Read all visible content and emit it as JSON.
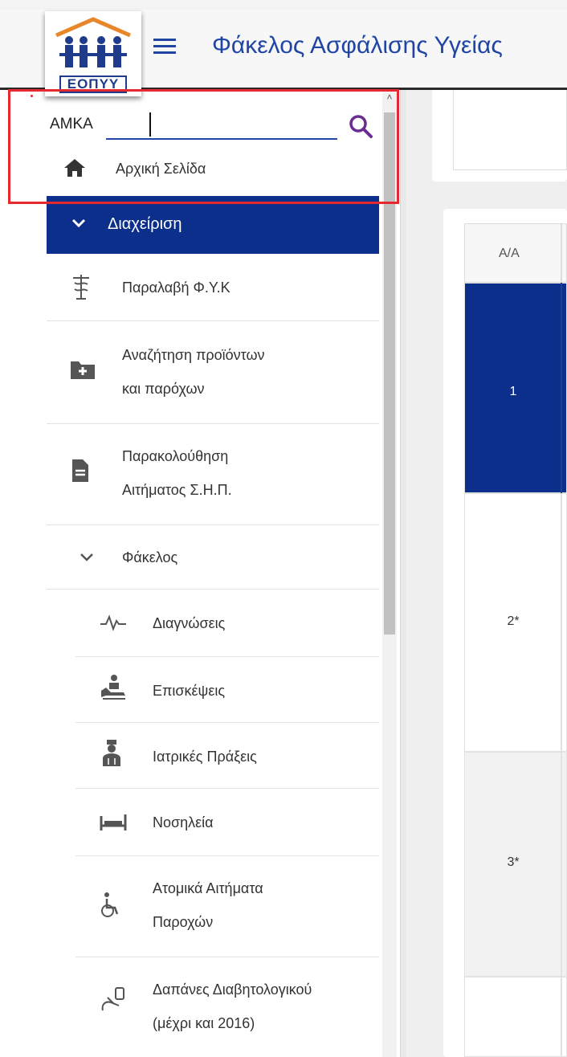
{
  "header": {
    "logo_text": "ΕΟΠΥΥ",
    "app_title": "Φάκελος Ασφάλισης Υγείας"
  },
  "search": {
    "label": "AMKA",
    "value": ""
  },
  "home": {
    "label": "Αρχική Σελίδα"
  },
  "menu": {
    "section_label": "Διαχείριση",
    "items": [
      {
        "label": "Παραλαβή Φ.Υ.Κ",
        "icon": "pharmacy-icon"
      },
      {
        "label_line1": "Αναζήτηση προϊόντων",
        "label_line2": "και παρόχων",
        "icon": "folder-plus-icon"
      },
      {
        "label_line1": "Παρακολούθηση",
        "label_line2": "Αιτήματος Σ.Η.Π.",
        "icon": "document-icon"
      },
      {
        "label": "Φάκελος",
        "icon": "chevron-down-icon"
      }
    ],
    "sub_items": [
      {
        "label": "Διαγνώσεις",
        "icon": "pulse-icon"
      },
      {
        "label": "Επισκέψεις",
        "icon": "doctor-visit-icon"
      },
      {
        "label": "Ιατρικές Πράξεις",
        "icon": "doctor-icon"
      },
      {
        "label": "Νοσηλεία",
        "icon": "bed-icon"
      },
      {
        "label_line1": "Ατομικά Αιτήματα",
        "label_line2": "Παροχών",
        "icon": "wheelchair-icon"
      },
      {
        "label_line1": "Δαπάνες Διαβητολογικού",
        "label_line2": "(μέχρι και 2016)",
        "icon": "diabetes-icon"
      }
    ]
  },
  "table": {
    "header_aa": "Α/Α",
    "rows": [
      {
        "aa": "1",
        "selected": true
      },
      {
        "aa": "2*",
        "selected": false
      },
      {
        "aa": "3*",
        "selected": false
      }
    ]
  },
  "colors": {
    "primary": "#0b2f8a",
    "title_blue": "#2045a4",
    "highlight_red": "#e6282f",
    "search_purple": "#6a2c91"
  }
}
